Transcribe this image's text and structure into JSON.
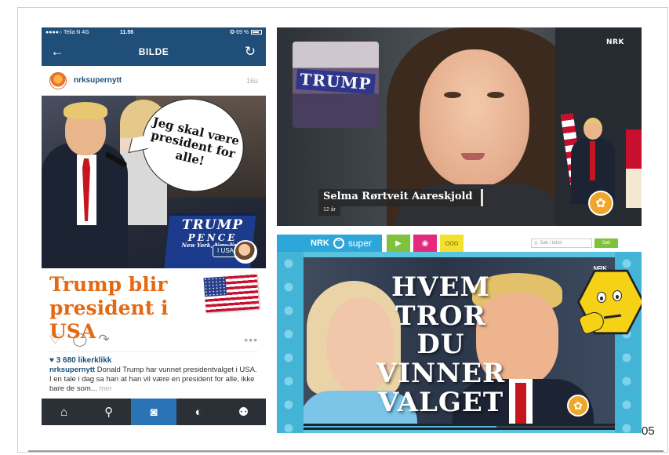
{
  "slide": {
    "number": "05"
  },
  "instagram": {
    "status_bar": {
      "carrier": "●●●●○ Telia N  4G",
      "time": "11.56",
      "battery": "✪ 69 %"
    },
    "header": {
      "title": "BILDE",
      "back_icon": "back-arrow-icon",
      "refresh_icon": "refresh-icon"
    },
    "post": {
      "username": "nrksupernytt",
      "time_ago": "16u",
      "speech_bubble": "Jeg skal være president for alle!",
      "podium": {
        "line1": "TRUMP",
        "line2": "PENCE",
        "line3": "New York, New York"
      },
      "usa_badge": "I USA",
      "headline": "Trump blir president i USA",
      "likes": "♥ 3 680 likerklikk",
      "caption_user": "nrksupernytt",
      "caption_text": "Donald Trump har vunnet presidentvalget i USA. I en tale i dag sa han at han vil være en president for alle, ikke bare de som...",
      "caption_more": "mer",
      "more_dots": "•••"
    },
    "tabbar": [
      "home-icon",
      "search-icon",
      "camera-icon",
      "activity-icon",
      "profile-icon"
    ]
  },
  "tv": {
    "channel_logo": "NRK",
    "rally_sign": "TRUMP",
    "name": "Selma Rørtveit Aareskjold",
    "age": "12 år"
  },
  "web": {
    "logo_nrk": "NRK",
    "logo_super": "super",
    "nav_buttons": [
      "play-icon",
      "pink-eye-icon",
      "yellow-dots-icon"
    ],
    "search_placeholder": "Søk i tekst",
    "search_button": "Søk",
    "video_nrk": "NRK",
    "video_title": "HVEM TROR DU VINNER VALGET",
    "progress": 0.62
  }
}
